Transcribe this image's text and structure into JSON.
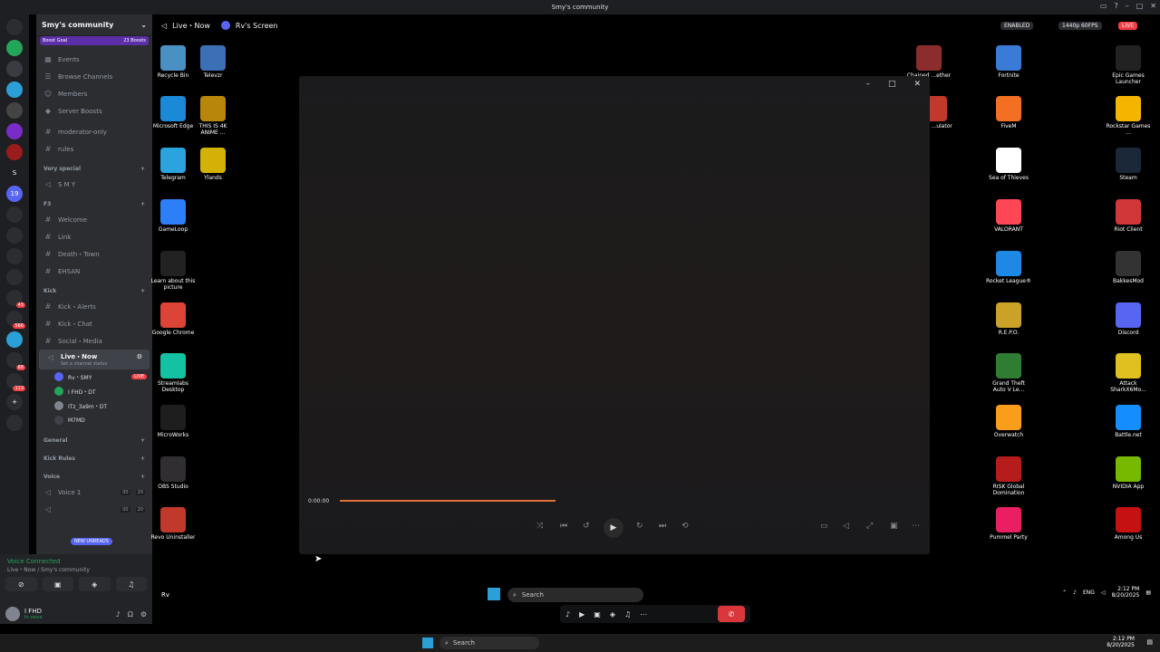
{
  "window": {
    "title": "Smy's community"
  },
  "servers": [
    {
      "label": "",
      "color": "#2b2d31",
      "icon": "discord-icon"
    },
    {
      "label": "",
      "color": "#23a55a",
      "badge": ""
    },
    {
      "label": "",
      "color": "#3a3c41"
    },
    {
      "label": "",
      "color": "#2b9fd6"
    },
    {
      "label": "",
      "color": "#444"
    },
    {
      "label": "",
      "color": "#7a2cc9"
    },
    {
      "label": "",
      "color": "#9b1c1c"
    },
    {
      "label": "S",
      "color": "#1e1f22"
    },
    {
      "label": "19",
      "color": "#5865f2"
    },
    {
      "label": "",
      "color": "#2b2d31"
    },
    {
      "label": "",
      "color": "#2b2d31"
    },
    {
      "label": "",
      "color": "#2b2d31"
    },
    {
      "label": "",
      "color": "#2b2d31"
    },
    {
      "label": "",
      "color": "#2b2d31",
      "badge": "43"
    },
    {
      "label": "",
      "color": "#2b2d31",
      "badge": "566"
    },
    {
      "label": "",
      "color": "#2b9fd6"
    },
    {
      "label": "",
      "color": "#2b2d31",
      "badge": "68"
    },
    {
      "label": "",
      "color": "#2b2d31",
      "badge": "113"
    },
    {
      "label": "+",
      "color": "#2b2d31"
    },
    {
      "label": "",
      "color": "#2b2d31"
    }
  ],
  "sidebar": {
    "server_name": "Smy's community",
    "boost_goal": "Boost Goal",
    "boosts": "23 Boosts",
    "top_items": [
      "Events",
      "Browse Channels",
      "Members",
      "Server Boosts"
    ],
    "channels_a": [
      "moderator-only",
      "rules"
    ],
    "cat_very_special": "Very special",
    "smy": "S M Y",
    "cat_f3": "F3",
    "f3": [
      "Welcome",
      "Link",
      "Death・Town",
      "EHSAN"
    ],
    "cat_kick": "Kick",
    "kick": [
      "Kick・Alerts",
      "Kick・Chat",
      "Social・Media"
    ],
    "live_now": "Live・Now",
    "live_status": "Set a channel status",
    "voice_users": [
      {
        "name": "Rv・SMY",
        "live": "LIVE"
      },
      {
        "name": "I FHD・DT",
        "live": ""
      },
      {
        "name": "ITz_3a9m・DT",
        "live": ""
      },
      {
        "name": "M7MD",
        "live": ""
      }
    ],
    "cat_general": "General",
    "cat_kick_rules": "Kick Rules",
    "cat_voice": "Voice",
    "voice1": "Voice 1",
    "voice_count1": "00",
    "voice_limit1": "20",
    "voice_count2": "00",
    "voice_limit2": "20",
    "new_unreads": "NEW UNREADS"
  },
  "voice_panel": {
    "title": "Voice Connected",
    "sub": "Live・Now / Smy's community"
  },
  "user_panel": {
    "name": "I FHD",
    "status": "In voice"
  },
  "stage": {
    "channel": "Live・Now",
    "screen": "Rv's Screen",
    "enabled": "ENABLED",
    "quality": "1440p 60FPS",
    "live": "LIVE"
  },
  "desktop_left": [
    {
      "label": "Recycle Bin",
      "color": "#4a90c2"
    },
    {
      "label": "Televzr",
      "color": "#3b6fb6"
    },
    {
      "label": "Microsoft Edge",
      "color": "#1b8ad6"
    },
    {
      "label": "THIS IS 4K ANIME ...",
      "color": "#b8860b"
    },
    {
      "label": "Telegram",
      "color": "#2aa3df"
    },
    {
      "label": "Ylands",
      "color": "#d4b106"
    },
    {
      "label": "GameLoop",
      "color": "#2d7ff9"
    },
    {
      "label": "Learn about this picture",
      "color": "#222"
    },
    {
      "label": "Google Chrome",
      "color": "#db4437"
    },
    {
      "label": "Streamlabs Desktop",
      "color": "#14c2a3"
    },
    {
      "label": "MicroWorks",
      "color": "#1e1e1e"
    },
    {
      "label": "OBS Studio",
      "color": "#302e31"
    },
    {
      "label": "Revo Uninstaller",
      "color": "#c0392b"
    }
  ],
  "desktop_right": [
    {
      "label": "Chained ...ether",
      "color": "#8b2d2d"
    },
    {
      "label": "Fortnite",
      "color": "#3a7bd5"
    },
    {
      "label": "Epic Games Launcher",
      "color": "#222"
    },
    {
      "label": "Food ...ulator",
      "color": "#c0392b"
    },
    {
      "label": "FiveM",
      "color": "#f36f21"
    },
    {
      "label": "Rockstar Games ...",
      "color": "#f4b400"
    },
    {
      "label": "Sea of Thieves",
      "color": "#fff"
    },
    {
      "label": "Steam",
      "color": "#1b2838"
    },
    {
      "label": "VALORANT",
      "color": "#ff4655"
    },
    {
      "label": "Riot Client",
      "color": "#d13639"
    },
    {
      "label": "Rocket League®",
      "color": "#1e88e5"
    },
    {
      "label": "BakkesMod",
      "color": "#333"
    },
    {
      "label": "R.E.P.O.",
      "color": "#c9a227"
    },
    {
      "label": "Discord",
      "color": "#5865f2"
    },
    {
      "label": "Grand Theft Auto V Le...",
      "color": "#2e7d32"
    },
    {
      "label": "Attack SharkX6Mo...",
      "color": "#e0c020"
    },
    {
      "label": "Overwatch",
      "color": "#f99e1a"
    },
    {
      "label": "Battle.net",
      "color": "#148eff"
    },
    {
      "label": "RISK Global Domination",
      "color": "#b71c1c"
    },
    {
      "label": "NVIDIA App",
      "color": "#76b900"
    },
    {
      "label": "Pummel Party",
      "color": "#e91e63"
    },
    {
      "label": "Among Us",
      "color": "#c51111"
    }
  ],
  "player": {
    "time": "0:00:00",
    "progress": 0.36
  },
  "taskbar_inner": {
    "left": "Rv",
    "search": "Search",
    "lang": "ENG",
    "time": "2:12 PM",
    "date": "8/20/2025"
  },
  "taskbar_outer": {
    "search": "Search",
    "time": "2:12 PM",
    "date": "8/20/2025"
  }
}
